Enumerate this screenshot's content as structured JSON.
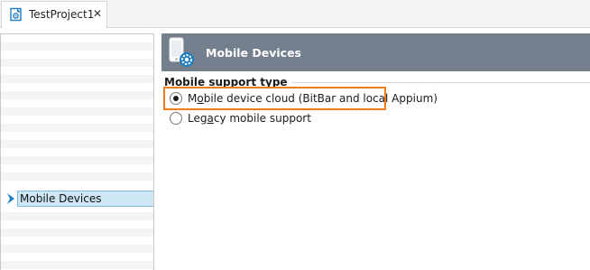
{
  "tabs": [
    {
      "label": "TestProject1",
      "icon": "project-file-icon",
      "close_glyph": "✕"
    }
  ],
  "tree": {
    "selected_item": {
      "label": "Mobile Devices",
      "icon": "chevron-right-icon"
    }
  },
  "page": {
    "title": "Mobile Devices",
    "icon": "mobile-device-gear-icon",
    "group_title": "Mobile support type",
    "options": [
      {
        "label_pre": "M",
        "label_ul": "o",
        "label_post": "bile device cloud (BitBar and local Appium)",
        "selected": true
      },
      {
        "label_pre": "Leg",
        "label_ul": "a",
        "label_post": "cy mobile support",
        "selected": false
      }
    ]
  },
  "colors": {
    "header_bg": "#737f8d",
    "highlight": "#ee7d1a",
    "selection_bg": "#cce6f4",
    "selection_border": "#7fbbe0",
    "accent_blue": "#1f7cc1"
  }
}
